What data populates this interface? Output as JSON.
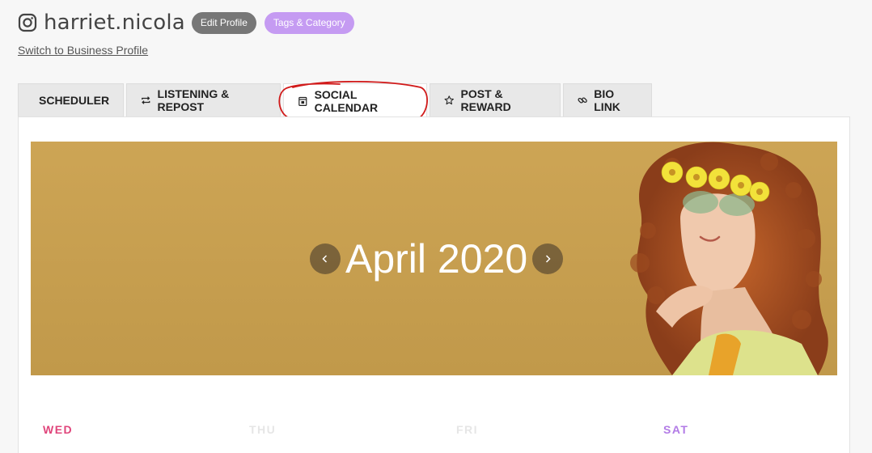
{
  "profile": {
    "username": "harriet.nicola",
    "edit_label": "Edit Profile",
    "tags_label": "Tags & Category",
    "switch_link": "Switch to Business Profile"
  },
  "tabs": [
    {
      "label": "SCHEDULER",
      "icon": "calendar-check-icon",
      "active": false
    },
    {
      "label": "LISTENING & REPOST",
      "icon": "repost-icon",
      "active": false
    },
    {
      "label": "SOCIAL CALENDAR",
      "icon": "calendar-icon",
      "active": true
    },
    {
      "label": "POST & REWARD",
      "icon": "star-icon",
      "active": false
    },
    {
      "label": "BIO LINK",
      "icon": "link-icon",
      "active": false
    }
  ],
  "calendar": {
    "month": "April 2020",
    "prev_icon": "chevron-left-icon",
    "next_icon": "chevron-right-icon",
    "days": [
      {
        "label": "WED",
        "color": "#e0457b"
      },
      {
        "label": "THU",
        "color": "#e6e6e6"
      },
      {
        "label": "FRI",
        "color": "#e6e6e6"
      },
      {
        "label": "SAT",
        "color": "#b27be6"
      }
    ]
  },
  "colors": {
    "banner": "#cba14e",
    "annotation": "#d11a1a",
    "tags_pill": "#c59bf2"
  }
}
